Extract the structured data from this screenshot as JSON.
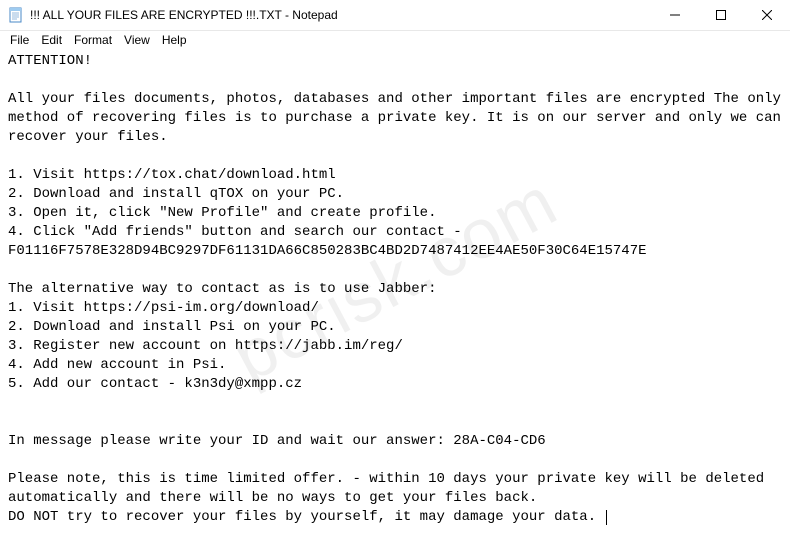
{
  "window": {
    "title": "!!! ALL YOUR FILES ARE ENCRYPTED !!!.TXT - Notepad"
  },
  "menu": {
    "file": "File",
    "edit": "Edit",
    "format": "Format",
    "view": "View",
    "help": "Help"
  },
  "body": {
    "text": "ATTENTION!\n\nAll your files documents, photos, databases and other important files are encrypted The only method of recovering files is to purchase a private key. It is on our server and only we can recover your files.\n\n1. Visit https://tox.chat/download.html\n2. Download and install qTOX on your PC.\n3. Open it, click \"New Profile\" and create profile.\n4. Click \"Add friends\" button and search our contact - F01116F7578E328D94BC9297DF61131DA66C850283BC4BD2D7487412EE4AE50F30C64E15747E\n\nThe alternative way to contact as is to use Jabber:\n1. Visit https://psi-im.org/download/\n2. Download and install Psi on your PC.\n3. Register new account on https://jabb.im/reg/\n4. Add new account in Psi.\n5. Add our contact - k3n3dy@xmpp.cz\n\n\nIn message please write your ID and wait our answer: 28A-C04-CD6\n\nPlease note, this is time limited offer. - within 10 days your private key will be deleted automatically and there will be no ways to get your files back.\nDO NOT try to recover your files by yourself, it may damage your data. "
  },
  "watermark": "pcrisk.com"
}
